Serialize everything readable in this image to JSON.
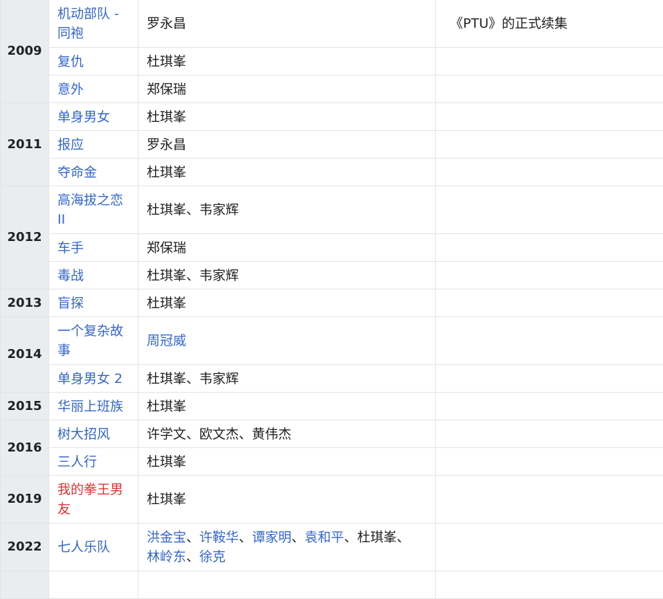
{
  "rows": {
    "r0": {
      "year": "2009",
      "title": "机动部队 - 同袍",
      "director": "罗永昌",
      "note": "《PTU》的正式续集"
    },
    "r1": {
      "title": "复仇",
      "director": "杜琪峯"
    },
    "r2": {
      "title": "意外",
      "director": "郑保瑞"
    },
    "r3": {
      "year": "2011",
      "title": "单身男女",
      "director": "杜琪峯"
    },
    "r4": {
      "title": "报应",
      "director": "罗永昌"
    },
    "r5": {
      "title": "夺命金",
      "director": "杜琪峯"
    },
    "r6": {
      "year": "2012",
      "title": "高海拔之恋II",
      "director": "杜琪峯、韦家辉"
    },
    "r7": {
      "title": "车手",
      "director": "郑保瑞"
    },
    "r8": {
      "title": "毒战",
      "director": "杜琪峯、韦家辉"
    },
    "r9": {
      "year": "2013",
      "title": "盲探",
      "director": "杜琪峯"
    },
    "r10": {
      "year": "2014",
      "title": "一个复杂故事",
      "director": "周冠威"
    },
    "r11": {
      "title": "单身男女 2",
      "director": "杜琪峯、韦家辉"
    },
    "r12": {
      "year": "2015",
      "title": "华丽上班族",
      "director": "杜琪峯"
    },
    "r13": {
      "year": "2016",
      "title": "树大招风",
      "director": "许学文、欧文杰、黄伟杰"
    },
    "r14": {
      "title": "三人行",
      "director": "杜琪峯"
    },
    "r15": {
      "year": "2019",
      "title": "我的拳王男友",
      "director": "杜琪峯"
    },
    "r16": {
      "year": "2022",
      "title": "七人乐队",
      "directors": {
        "d1": "洪金宝",
        "d2": "许鞍华",
        "d3": "谭家明",
        "d4": "袁和平",
        "d5": "杜琪峯",
        "d6": "林岭东",
        "d7": "徐克"
      },
      "sep": "、"
    }
  },
  "colors": {
    "link": "#3366cc",
    "redlink": "#dd3333",
    "year_bg": "#eaecf0",
    "border": "#e2e3e6"
  }
}
